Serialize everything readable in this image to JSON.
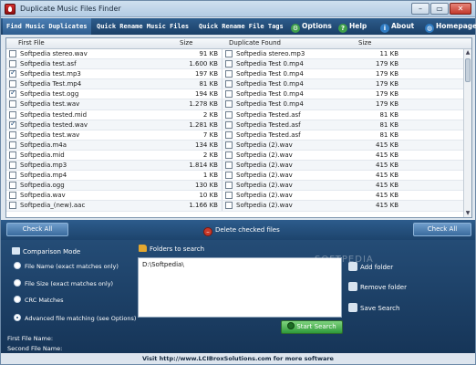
{
  "window": {
    "title": "Duplicate Music Files Finder"
  },
  "tabs": [
    {
      "label": "Find Music Duplicates",
      "active": true
    },
    {
      "label": "Quick Rename Music Files",
      "active": false
    },
    {
      "label": "Quick Rename File Tags",
      "active": false
    }
  ],
  "topnav": {
    "options": "Options",
    "help": "Help",
    "about": "About",
    "homepage": "Homepage"
  },
  "grid": {
    "columns": [
      "First File",
      "Size",
      "Duplicate Found",
      "Size"
    ],
    "rows": [
      {
        "checked": false,
        "first": "Softpedia stereo.wav",
        "size1": "91 KB",
        "dup": "Softpedia stereo.mp3",
        "size2": "11 KB"
      },
      {
        "checked": false,
        "first": "Softpedia test.asf",
        "size1": "1.600 KB",
        "dup": "Softpedia Test 0.mp4",
        "size2": "179 KB"
      },
      {
        "checked": true,
        "first": "Softpedia test.mp3",
        "size1": "197 KB",
        "dup": "Softpedia Test 0.mp4",
        "size2": "179 KB"
      },
      {
        "checked": false,
        "first": "Softpedia Test.mp4",
        "size1": "81 KB",
        "dup": "Softpedia Test 0.mp4",
        "size2": "179 KB"
      },
      {
        "checked": true,
        "first": "Softpedia test.ogg",
        "size1": "194 KB",
        "dup": "Softpedia Test 0.mp4",
        "size2": "179 KB"
      },
      {
        "checked": false,
        "first": "Softpedia test.wav",
        "size1": "1.278 KB",
        "dup": "Softpedia Test 0.mp4",
        "size2": "179 KB"
      },
      {
        "checked": false,
        "first": "Softpedia tested.mid",
        "size1": "2 KB",
        "dup": "Softpedia Tested.asf",
        "size2": "81 KB"
      },
      {
        "checked": true,
        "first": "Softpedia tested.wav",
        "size1": "1.281 KB",
        "dup": "Softpedia Tested.asf",
        "size2": "81 KB"
      },
      {
        "checked": false,
        "first": "Softpedia test.wav",
        "size1": "7 KB",
        "dup": "Softpedia Tested.asf",
        "size2": "81 KB"
      },
      {
        "checked": false,
        "first": "Softpedia.m4a",
        "size1": "134 KB",
        "dup": "Softpedia (2).wav",
        "size2": "415 KB"
      },
      {
        "checked": false,
        "first": "Softpedia.mid",
        "size1": "2 KB",
        "dup": "Softpedia (2).wav",
        "size2": "415 KB"
      },
      {
        "checked": false,
        "first": "Softpedia.mp3",
        "size1": "1.814 KB",
        "dup": "Softpedia (2).wav",
        "size2": "415 KB"
      },
      {
        "checked": false,
        "first": "Softpedia.mp4",
        "size1": "1 KB",
        "dup": "Softpedia (2).wav",
        "size2": "415 KB"
      },
      {
        "checked": false,
        "first": "Softpedia.ogg",
        "size1": "130 KB",
        "dup": "Softpedia (2).wav",
        "size2": "415 KB"
      },
      {
        "checked": false,
        "first": "Softpedia.wav",
        "size1": "10 KB",
        "dup": "Softpedia (2).wav",
        "size2": "415 KB"
      },
      {
        "checked": false,
        "first": "Softpedia_(new).aac",
        "size1": "1.166 KB",
        "dup": "Softpedia (2).wav",
        "size2": "415 KB"
      }
    ]
  },
  "actions": {
    "check_all_left": "Check All",
    "delete_checked": "Delete checked files",
    "check_all_right": "Check All"
  },
  "comparison": {
    "title": "Comparison Mode",
    "options": [
      {
        "label": "File Name (exact matches only)",
        "selected": false
      },
      {
        "label": "File Size (exact matches only)",
        "selected": false
      },
      {
        "label": "CRC Matches",
        "selected": false
      },
      {
        "label": "Advanced file matching (see Options)",
        "selected": true
      }
    ]
  },
  "folders": {
    "title": "Folders to search",
    "items": [
      "D:\\Softpedia\\"
    ],
    "add_folder": "Add folder",
    "remove_folder": "Remove folder",
    "save_search": "Save Search",
    "start_search": "Start Search"
  },
  "file_names": {
    "first_label": "First File Name:",
    "second_label": "Second File Name:"
  },
  "footer": {
    "text": "Visit http://www.LCIBroxSolutions.com for more software"
  },
  "watermark": {
    "text": "SOFTPEDIA"
  },
  "colors": {
    "header_blue": "#1b3f66",
    "panel_blue": "#163558",
    "accent_green": "#2f9a3a",
    "danger_red": "#c73a2a"
  }
}
